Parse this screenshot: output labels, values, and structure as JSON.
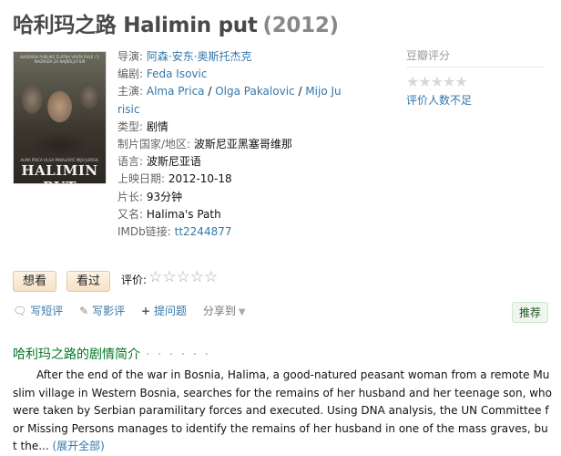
{
  "movie": {
    "title": "哈利玛之路 Halimin put",
    "year": "(2012)"
  },
  "poster": {
    "top_text": "NAGRADA PUBLIKE ZLATNA VRATA PULE / 5 NAGRADA ZA NAJBOLJI FILM",
    "names_text": "ALMA PRICA  OLGA PAKALOVIC  MIJO JURISIC",
    "title_text": "HALIMIN PUT"
  },
  "info": {
    "director_label": "导演:",
    "director": "阿森·安东·奥斯托杰克",
    "writer_label": "编剧:",
    "writer": "Feda Isovic",
    "cast_label": "主演:",
    "cast": [
      "Alma Prica",
      "Olga Pakalovic",
      "Mijo Jurisic"
    ],
    "cast_sep": " / ",
    "genre_label": "类型:",
    "genre": "剧情",
    "country_label": "制片国家/地区:",
    "country": "波斯尼亚黑塞哥维那",
    "language_label": "语言:",
    "language": "波斯尼亚语",
    "release_label": "上映日期:",
    "release": "2012-10-18",
    "runtime_label": "片长:",
    "runtime": "93分钟",
    "aka_label": "又名:",
    "aka": "Halima's Path",
    "imdb_label": "IMDb链接:",
    "imdb": "tt2244877"
  },
  "rating": {
    "label": "豆瓣评分",
    "stars": "★★★★★",
    "status": "评价人数不足"
  },
  "buttons": {
    "want": "想看",
    "seen": "看过",
    "rate_label": "评价:",
    "rate_stars": "☆☆☆☆☆"
  },
  "actions": {
    "short_review": "写短评",
    "review": "写影评",
    "ask": "提问题",
    "share": "分享到",
    "recommend": "推荐"
  },
  "summary": {
    "heading": "哈利玛之路的剧情简介",
    "dots": "· · · · · ·",
    "text": "After the end of the war in Bosnia, Halima, a good-natured peasant woman from a remote Muslim village in Western Bosnia, searches for the remains of her husband and her teenage son, who were taken by Serbian paramilitary forces and executed. Using DNA analysis, the UN Committee for Missing Persons manages to identify the remains of her husband in one of the mass graves, but the...",
    "more": "(展开全部)"
  }
}
